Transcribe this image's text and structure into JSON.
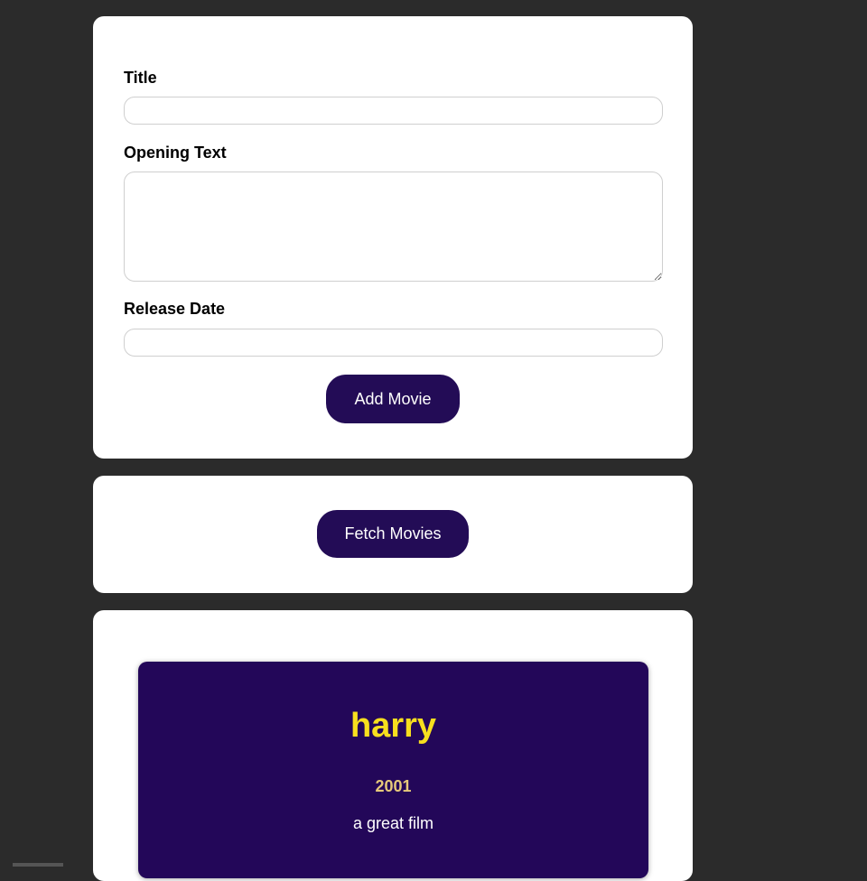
{
  "form": {
    "title_label": "Title",
    "title_value": "",
    "opening_text_label": "Opening Text",
    "opening_text_value": "",
    "release_date_label": "Release Date",
    "release_date_value": "",
    "submit_label": "Add Movie"
  },
  "actions": {
    "fetch_label": "Fetch Movies"
  },
  "movies": [
    {
      "title": "harry",
      "release_date": "2001",
      "opening_text": "a great film"
    }
  ],
  "colors": {
    "page_background": "#2b2b2b",
    "card_background": "#ffffff",
    "button_background": "#230c56",
    "movie_card_background": "#230759",
    "movie_title_color": "#f7df1e",
    "movie_date_color": "#e6c97a"
  }
}
